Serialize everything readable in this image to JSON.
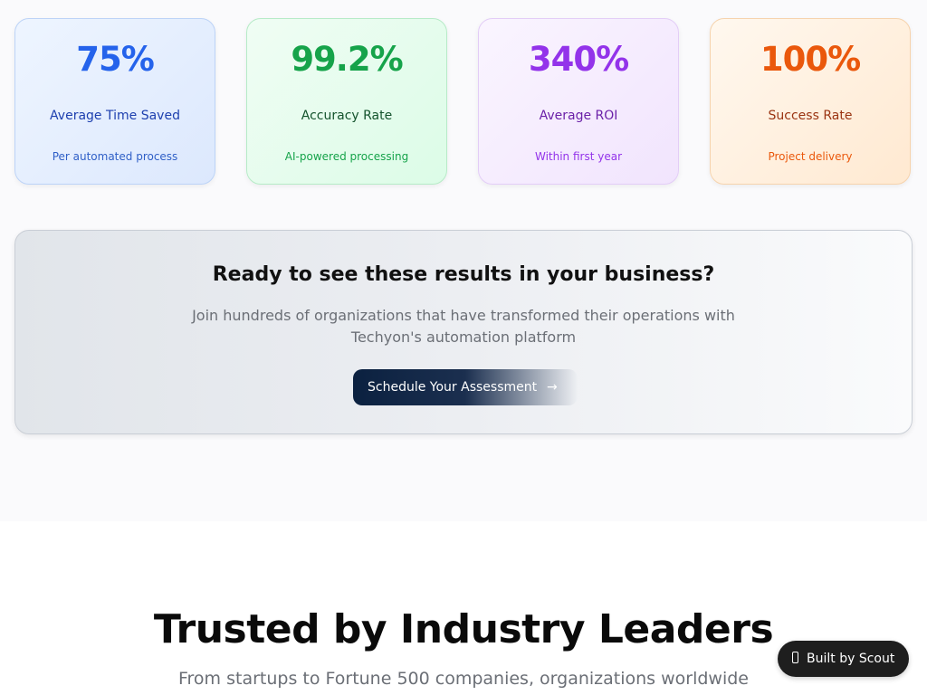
{
  "stats": [
    {
      "value": "75%",
      "label": "Average Time Saved",
      "sub": "Per automated process"
    },
    {
      "value": "99.2%",
      "label": "Accuracy Rate",
      "sub": "AI-powered processing"
    },
    {
      "value": "340%",
      "label": "Average ROI",
      "sub": "Within first year"
    },
    {
      "value": "100%",
      "label": "Success Rate",
      "sub": "Project delivery"
    }
  ],
  "cta": {
    "title": "Ready to see these results in your business?",
    "description": "Join hundreds of organizations that have transformed their operations with Techyon's automation platform",
    "button_label": "Schedule Your Assessment",
    "button_icon": "→"
  },
  "trusted": {
    "title": "Trusted by Industry Leaders",
    "subtitle": "From startups to Fortune 500 companies, organizations worldwide"
  },
  "badge": {
    "label": "Built by Scout",
    "icon": "device-icon"
  },
  "colors": {
    "blue": "#2563eb",
    "green": "#16a34a",
    "purple": "#9333ea",
    "orange": "#ea580c",
    "cta_button": "#0b2140"
  }
}
